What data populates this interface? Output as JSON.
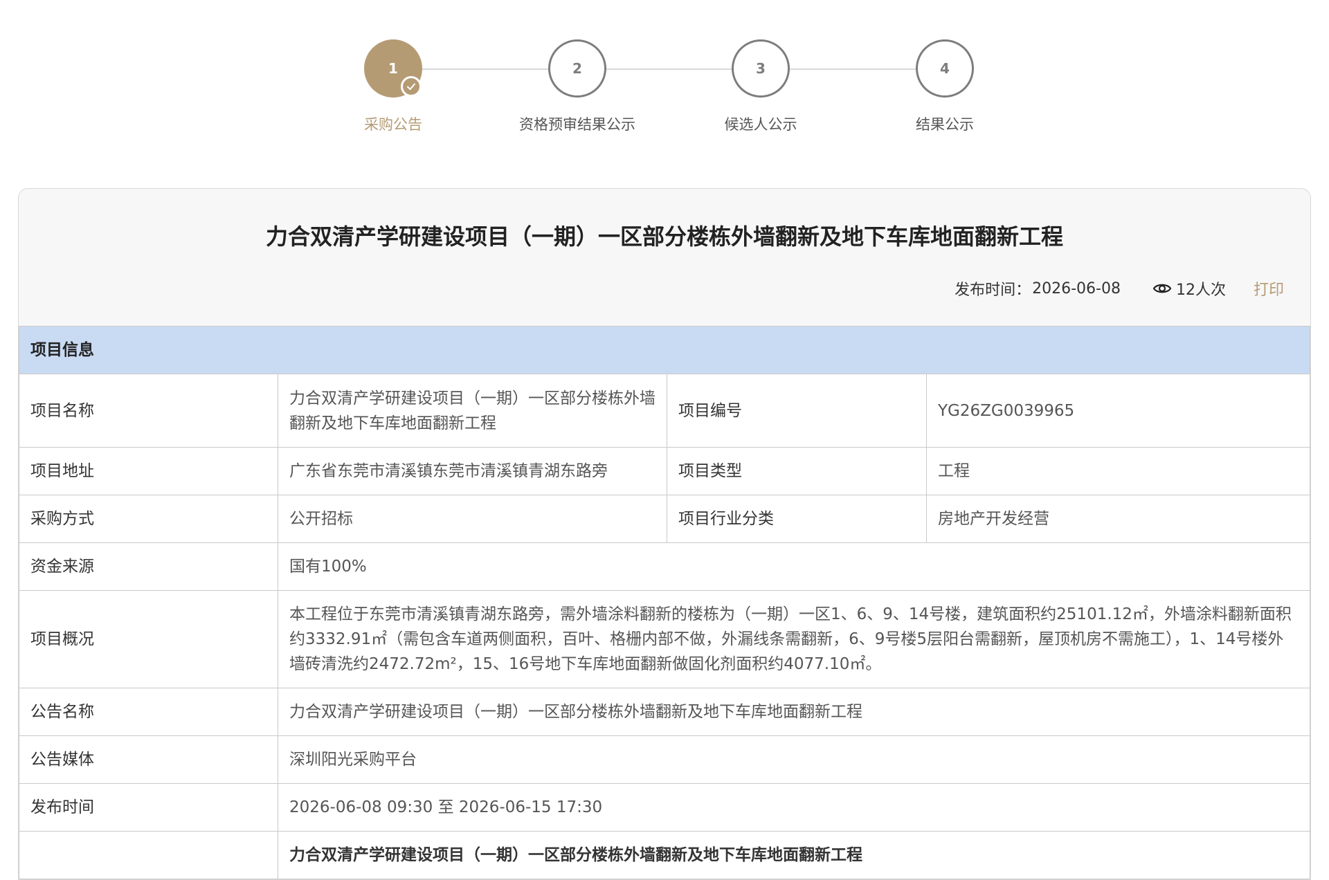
{
  "stepper": {
    "steps": [
      {
        "number": "1",
        "label": "采购公告",
        "active": true
      },
      {
        "number": "2",
        "label": "资格预审结果公示",
        "active": false
      },
      {
        "number": "3",
        "label": "候选人公示",
        "active": false
      },
      {
        "number": "4",
        "label": "结果公示",
        "active": false
      }
    ],
    "accent_color": "#b59b74"
  },
  "notice": {
    "title": "力合双清产学研建设项目（一期）一区部分楼栋外墙翻新及地下车库地面翻新工程",
    "publish_label": "发布时间：",
    "publish_date": "2026-06-08",
    "views": "12人次",
    "print_label": "打印"
  },
  "project_info": {
    "section_title": "项目信息",
    "name_label": "项目名称",
    "name_value": "力合双清产学研建设项目（一期）一区部分楼栋外墙翻新及地下车库地面翻新工程",
    "code_label": "项目编号",
    "code_value": "YG26ZG0039965",
    "address_label": "项目地址",
    "address_value": "广东省东莞市清溪镇东莞市清溪镇青湖东路旁",
    "type_label": "项目类型",
    "type_value": "工程",
    "method_label": "采购方式",
    "method_value": "公开招标",
    "industry_label": "项目行业分类",
    "industry_value": "房地产开发经营",
    "fund_label": "资金来源",
    "fund_value": "国有100%",
    "overview_label": "项目概况",
    "overview_value": "本工程位于东莞市清溪镇青湖东路旁，需外墙涂料翻新的楼栋为（一期）一区1、6、9、14号楼，建筑面积约25101.12㎡，外墙涂料翻新面积约3332.91㎡（需包含车道两侧面积，百叶、格栅内部不做，外漏线条需翻新，6、9号楼5层阳台需翻新，屋顶机房不需施工），1、14号楼外墙砖清洗约2472.72m²，15、16号地下车库地面翻新做固化剂面积约4077.10㎡。",
    "notice_name_label": "公告名称",
    "notice_name_value": "力合双清产学研建设项目（一期）一区部分楼栋外墙翻新及地下车库地面翻新工程",
    "media_label": "公告媒体",
    "media_value": "深圳阳光采购平台",
    "time_label": "发布时间",
    "time_value": "2026-06-08 09:30 至 2026-06-15 17:30",
    "last_row_value": "力合双清产学研建设项目（一期）一区部分楼栋外墙翻新及地下车库地面翻新工程"
  }
}
